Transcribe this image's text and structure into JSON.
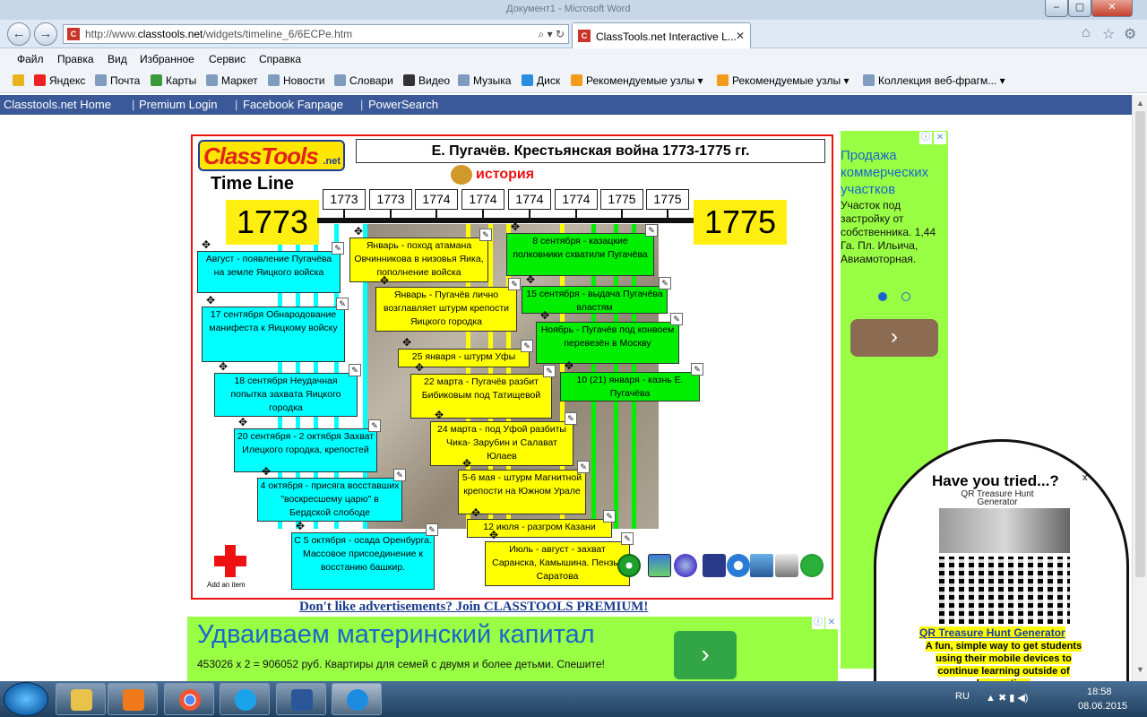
{
  "window": {
    "title": "Документ1 - Microsoft Word"
  },
  "browser": {
    "url_prefix": "http://www.",
    "url_domain": "classtools.net",
    "url_rest": "/widgets/timeline_6/6ECPe.htm",
    "tab_title": "ClassTools.net Interactive L...",
    "menu": [
      "Файл",
      "Правка",
      "Вид",
      "Избранное",
      "Сервис",
      "Справка"
    ],
    "favorites": [
      "Яндекс",
      "Почта",
      "Карты",
      "Маркет",
      "Новости",
      "Словари",
      "Видео",
      "Музыка",
      "Диск",
      "Рекомендуемые узлы ▾",
      "Рекомендуемые узлы ▾",
      "Коллекция веб-фрагм... ▾"
    ]
  },
  "site_nav": [
    "Classtools.net Home",
    "Premium Login",
    "Facebook Fanpage",
    "PowerSearch"
  ],
  "timeline": {
    "logo": "ClassTools",
    "logo_suffix": ".net",
    "title": "Е. Пугачёв. Крестьянская война 1773-1775 гг.",
    "label": "Time Line",
    "category": "история",
    "start_year": "1773",
    "end_year": "1775",
    "ticks": [
      "1773",
      "1773",
      "1774",
      "1774",
      "1774",
      "1774",
      "1775",
      "1775"
    ],
    "events": [
      {
        "text": "Август - появление Пугачёва на земле Яицкого войска",
        "color": "cyan"
      },
      {
        "text": "17 сентября Обнародование манифеста к Яицкому войску",
        "color": "cyan"
      },
      {
        "text": "18 сентября Неудачная попытка захвата Яицкого городка",
        "color": "cyan"
      },
      {
        "text": "20 сентября - 2 октября Захват Илецкого городка, крепостей",
        "color": "cyan"
      },
      {
        "text": "4 октября - присяга восставших \"воскресшему царю\" в Бердской слободе",
        "color": "cyan"
      },
      {
        "text": "С 5 октября - осада Оренбурга. Массовое присоединение к восстанию башкир.",
        "color": "cyan"
      },
      {
        "text": "Январь - поход атамана Овчинникова в низовья Яика, пополнение войска",
        "color": "yellow"
      },
      {
        "text": "Январь - Пугачёв лично возглавляет штурм крепости Яицкого городка",
        "color": "yellow"
      },
      {
        "text": "25 января - штурм Уфы",
        "color": "yellow"
      },
      {
        "text": "22 марта - Пугачёв разбит Бибиковым под Татищевой",
        "color": "yellow"
      },
      {
        "text": "24 марта - под Уфой разбиты Чика- Зарубин и Салават Юлаев",
        "color": "yellow"
      },
      {
        "text": "5-6 мая - штурм Магнитной крепости на Южном Урале",
        "color": "yellow"
      },
      {
        "text": "12 июля - разгром Казани",
        "color": "yellow"
      },
      {
        "text": "Июль - август - захват Саранска, Камышина. Пензы, Саратова",
        "color": "yellow"
      },
      {
        "text": "8 сентября - казацкие полковники схватили Пугачёва",
        "color": "green"
      },
      {
        "text": "15 сентября - выдача Пугачёва властям",
        "color": "green"
      },
      {
        "text": "Ноябрь - Пугачёв под конвоем перевезён в Москву",
        "color": "green"
      },
      {
        "text": "10 (21) января - казнь Е. Пугачёва",
        "color": "green"
      }
    ],
    "add_item": "Add an item"
  },
  "premium_link": "Don't like advertisements? Join CLASSTOOLS PREMIUM!",
  "ad_right": {
    "heading": "Продажа коммерческих участков",
    "text": "Участок под застройку от собственника. 1,44 Га. Пл. Ильича, Авиамоторная."
  },
  "ad_bottom": {
    "heading": "Удваиваем материнский капитал",
    "text": "453026 x 2 = 906052 руб. Квартиры для семей с двумя и более детьми. Спешите!"
  },
  "popup": {
    "title": "Have you tried...?",
    "close": "x",
    "subtitle": "QR Treasure Hunt Generator",
    "link": "QR Treasure Hunt Generator",
    "desc": "A fun, simple way to get students using their mobile devices to continue learning outside of lesson time"
  },
  "taskbar": {
    "lang": "RU",
    "time": "18:58",
    "date": "08.06.2015"
  },
  "colors": {
    "cyan": "#00ffff",
    "yellow": "#ffff00",
    "green": "#00ee00",
    "nav": "#3b5998",
    "accent": "#e11111"
  }
}
